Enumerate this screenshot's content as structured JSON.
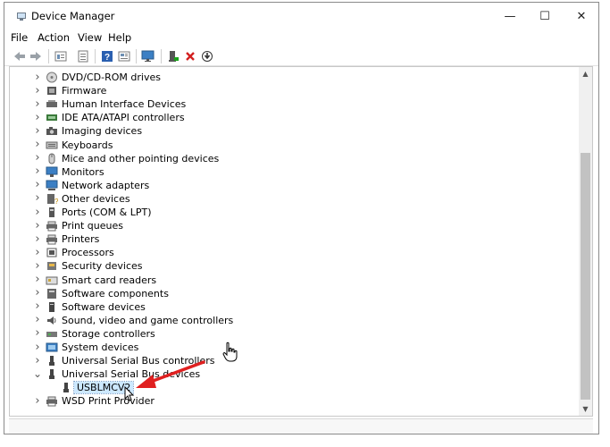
{
  "window": {
    "title": "Device Manager",
    "controls": {
      "minimize": "—",
      "maximize": "☐",
      "close": "✕"
    }
  },
  "menu": [
    "File",
    "Action",
    "View",
    "Help"
  ],
  "toolbar": {
    "buttons": [
      "back-icon",
      "forward-icon",
      "properties-icon",
      "show-hide-icon",
      "help-icon",
      "view-icon",
      "monitor-scan-icon",
      "enable-device-icon",
      "uninstall-icon",
      "update-driver-icon"
    ]
  },
  "tree": {
    "items": [
      {
        "label": "DVD/CD-ROM drives",
        "icon": "dvd-icon"
      },
      {
        "label": "Firmware",
        "icon": "firmware-icon"
      },
      {
        "label": "Human Interface Devices",
        "icon": "hid-icon"
      },
      {
        "label": "IDE ATA/ATAPI controllers",
        "icon": "ide-icon"
      },
      {
        "label": "Imaging devices",
        "icon": "camera-icon"
      },
      {
        "label": "Keyboards",
        "icon": "keyboard-icon"
      },
      {
        "label": "Mice and other pointing devices",
        "icon": "mouse-icon"
      },
      {
        "label": "Monitors",
        "icon": "monitor-icon"
      },
      {
        "label": "Network adapters",
        "icon": "network-icon"
      },
      {
        "label": "Other devices",
        "icon": "other-devices-icon"
      },
      {
        "label": "Ports (COM & LPT)",
        "icon": "port-icon"
      },
      {
        "label": "Print queues",
        "icon": "printer-icon"
      },
      {
        "label": "Printers",
        "icon": "printer-icon"
      },
      {
        "label": "Processors",
        "icon": "processor-icon"
      },
      {
        "label": "Security devices",
        "icon": "security-icon"
      },
      {
        "label": "Smart card readers",
        "icon": "smartcard-icon"
      },
      {
        "label": "Software components",
        "icon": "software-component-icon"
      },
      {
        "label": "Software devices",
        "icon": "software-device-icon"
      },
      {
        "label": "Sound, video and game controllers",
        "icon": "sound-icon"
      },
      {
        "label": "Storage controllers",
        "icon": "storage-icon"
      },
      {
        "label": "System devices",
        "icon": "system-icon"
      },
      {
        "label": "Universal Serial Bus controllers",
        "icon": "usb-icon"
      },
      {
        "label": "Universal Serial Bus devices",
        "icon": "usb-icon",
        "expanded": true
      },
      {
        "label": "USBLMCV2",
        "icon": "usb-device-icon",
        "child": true,
        "selected": true
      },
      {
        "label": "WSD Print Provider",
        "icon": "printer-icon"
      }
    ]
  },
  "colors": {
    "annotation_arrow": "#e02020",
    "selection": "#cce8ff"
  }
}
